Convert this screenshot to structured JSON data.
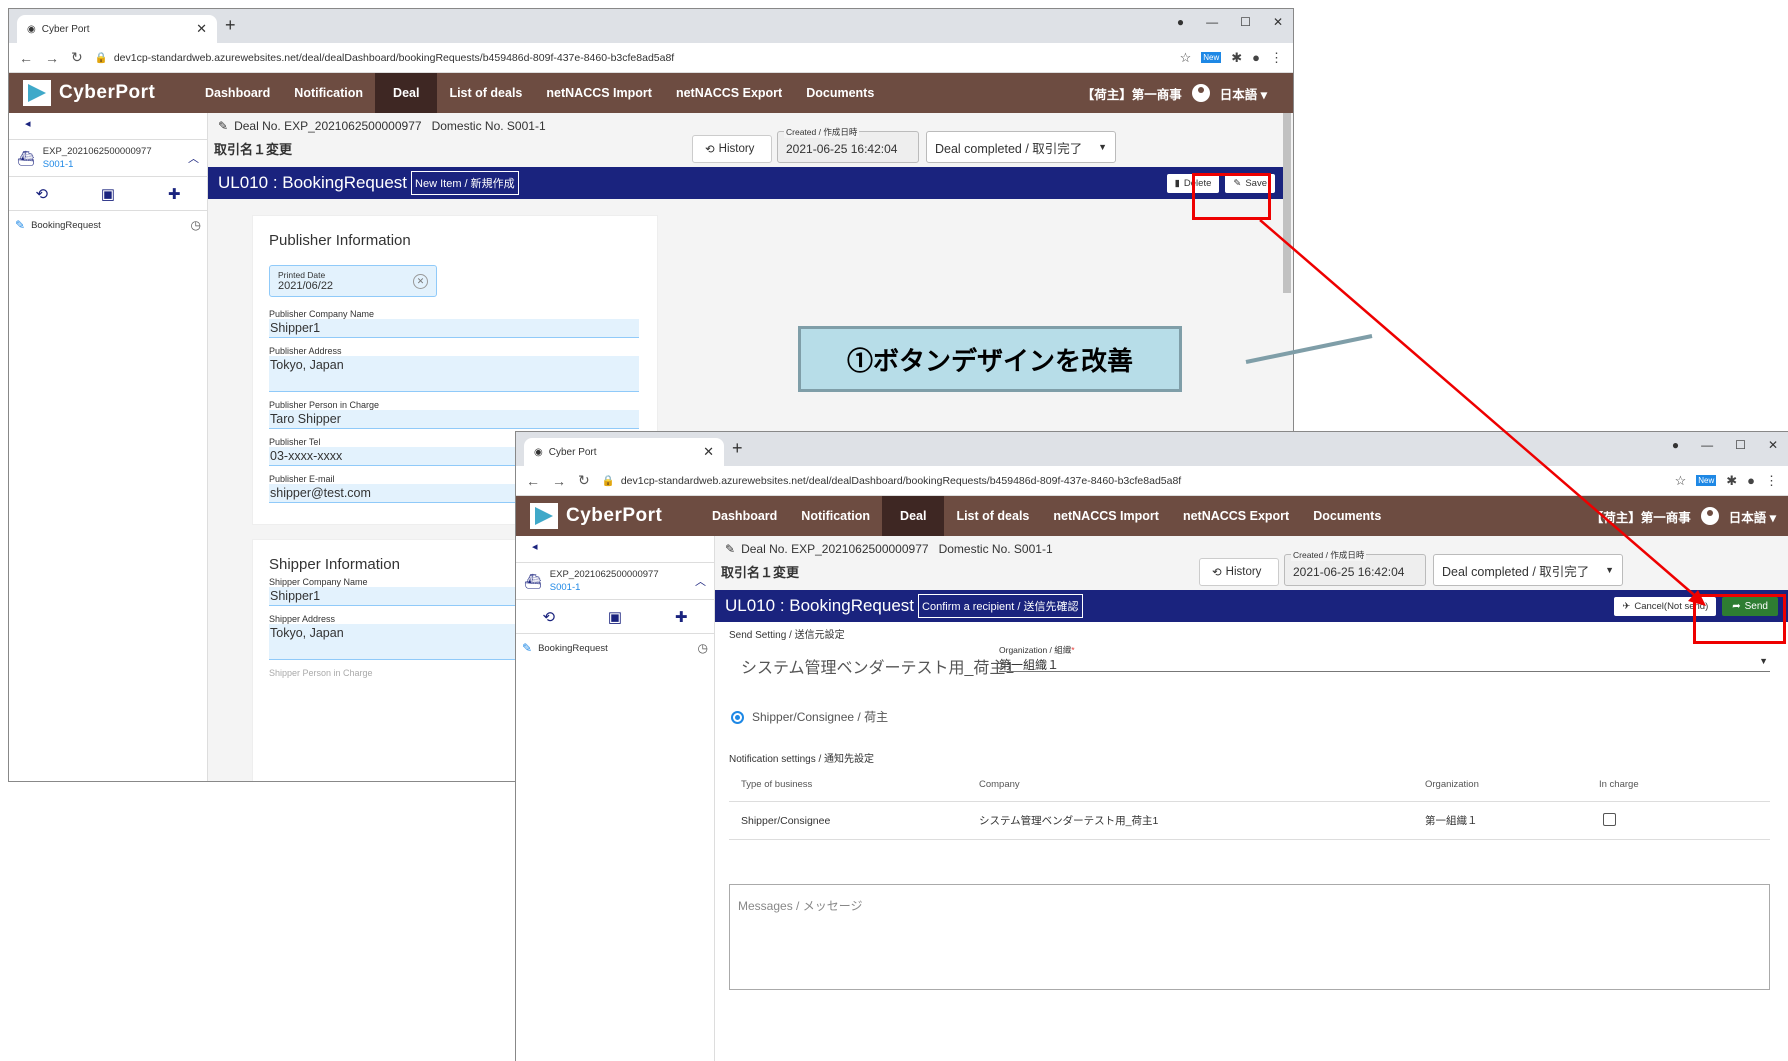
{
  "browser": {
    "tab_title": "Cyber Port",
    "url": "dev1cp-standardweb.azurewebsites.net/deal/dealDashboard/bookingRequests/b459486d-809f-437e-8460-b3cfe8ad5a8f",
    "new_badge": "New"
  },
  "app": {
    "brand": "CyberPort",
    "menu": [
      "Dashboard",
      "Notification",
      "Deal",
      "List of deals",
      "netNACCS Import",
      "netNACCS Export",
      "Documents"
    ],
    "active_menu": "Deal",
    "user": "【荷主】第一商事",
    "language": "日本語"
  },
  "sidebar": {
    "deal_id": "EXP_2021062500000977",
    "deal_sub": "S001-1",
    "doc": "BookingRequest"
  },
  "deal": {
    "deal_no": "Deal No. EXP_2021062500000977",
    "domestic_no": "Domestic No. S001-1",
    "name": "取引名１変更",
    "history": "History",
    "created_label": "Created / 作成日時",
    "created_value": "2021-06-25 16:42:04",
    "status": "Deal completed / 取引完了"
  },
  "screen1": {
    "title": "UL010 : BookingRequest",
    "tag": "New Item / 新規作成",
    "delete": "Delete",
    "save": "Save",
    "publisher_title": "Publisher Information",
    "printed_label": "Printed Date",
    "printed_value": "2021/06/22",
    "publisher_fields": [
      {
        "label": "Publisher Company Name",
        "value": "Shipper1"
      },
      {
        "label": "Publisher Address",
        "value": "Tokyo, Japan"
      },
      {
        "label": "Publisher Person in Charge",
        "value": "Taro Shipper"
      },
      {
        "label": "Publisher Tel",
        "value": "03-xxxx-xxxx"
      },
      {
        "label": "Publisher E-mail",
        "value": "shipper@test.com"
      }
    ],
    "shipper_title": "Shipper Information",
    "shipper_fields": [
      {
        "label": "Shipper Company Name",
        "value": "Shipper1"
      },
      {
        "label": "Shipper Address",
        "value": "Tokyo, Japan"
      },
      {
        "label": "Shipper Person in Charge",
        "value": ""
      }
    ]
  },
  "callout": "①ボタンデザインを改善",
  "screen2": {
    "title": "UL010 : BookingRequest",
    "tag": "Confirm a recipient / 送信先確認",
    "cancel": "Cancel(Not send)",
    "send": "Send",
    "send_setting": "Send Setting / 送信元設定",
    "sender_company": "システム管理ベンダーテスト用_荷主1",
    "org_label": "Organization / 組織",
    "org_value": "第一組織１",
    "radio_label": "Shipper/Consignee / 荷主",
    "notification_settings": "Notification settings / 通知先設定",
    "table_headers": [
      "Type of business",
      "Company",
      "Organization",
      "In charge"
    ],
    "table_rows": [
      [
        "Shipper/Consignee",
        "システム管理ベンダーテスト用_荷主1",
        "第一組織１"
      ]
    ],
    "messages_placeholder": "Messages / メッセージ"
  },
  "colors": {
    "appbar": "#6d4c41",
    "titlebar": "#1a237e",
    "send": "#2e7d32",
    "highlight": "#ee0000"
  }
}
